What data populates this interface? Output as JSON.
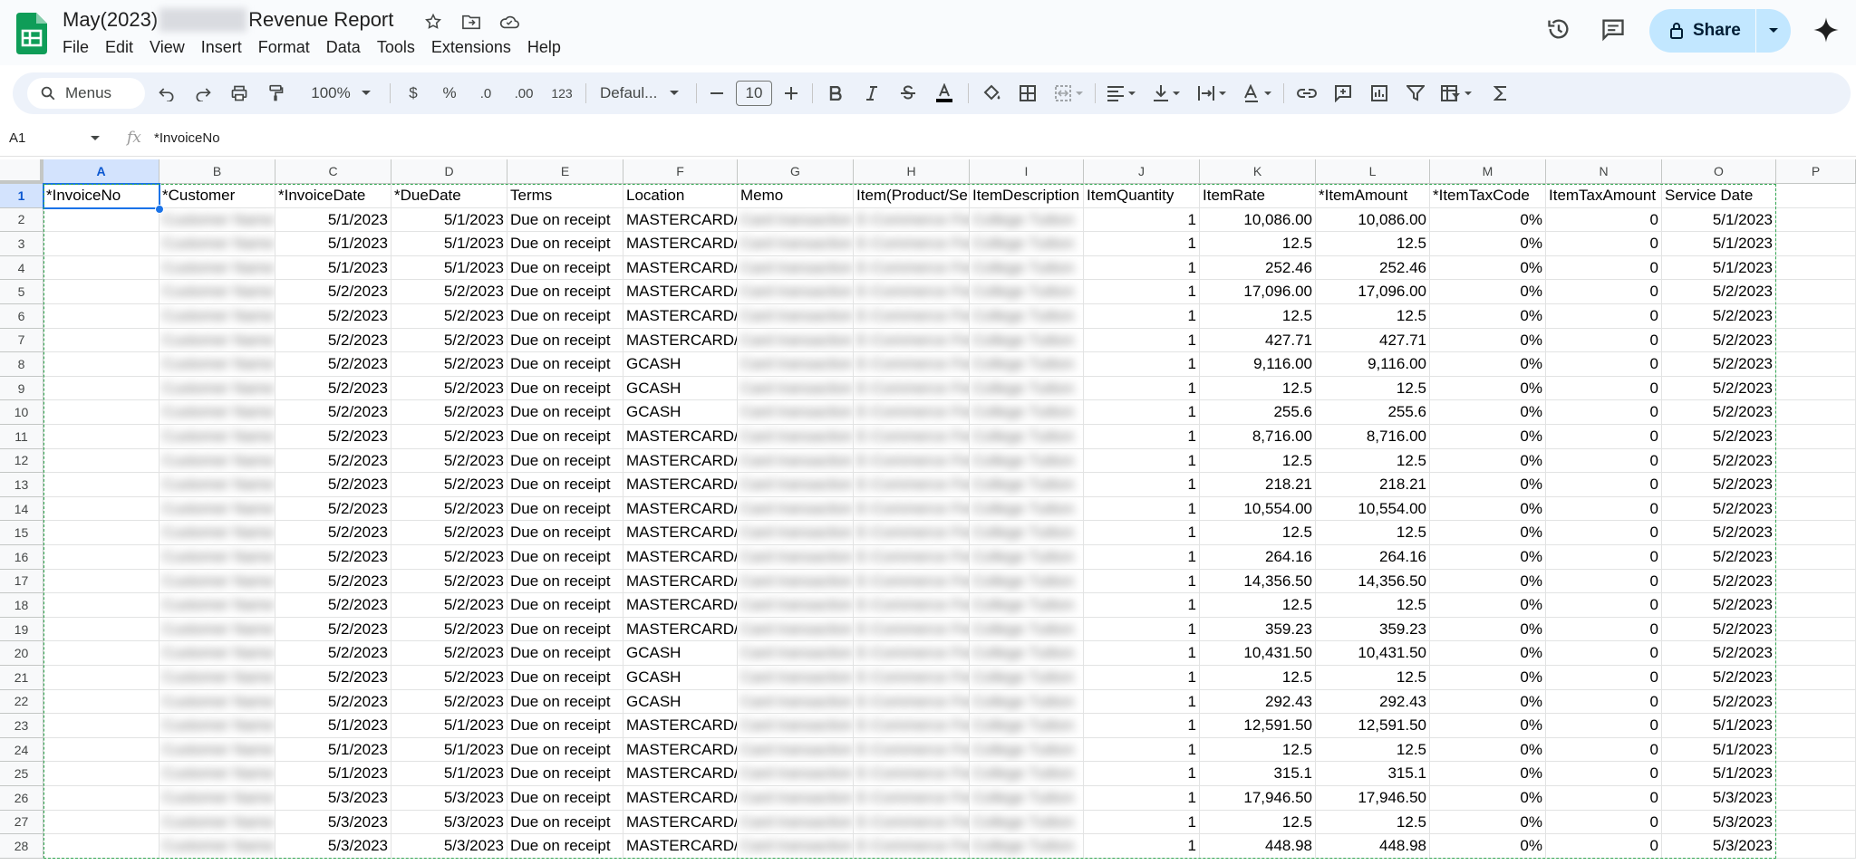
{
  "doc": {
    "title_prefix": "May(2023)",
    "title_suffix": "Revenue Report"
  },
  "menu": [
    "File",
    "Edit",
    "View",
    "Insert",
    "Format",
    "Data",
    "Tools",
    "Extensions",
    "Help"
  ],
  "share_label": "Share",
  "toolbar": {
    "search": "Menus",
    "zoom": "100%",
    "currency": "$",
    "percent": "%",
    "dec_decrease": ".0",
    "dec_increase": ".00",
    "format_123": "123",
    "font": "Defaul...",
    "font_size": "10"
  },
  "formula": {
    "cell_ref": "A1",
    "fx": "fx",
    "value": "*InvoiceNo"
  },
  "columns": [
    "A",
    "B",
    "C",
    "D",
    "E",
    "F",
    "G",
    "H",
    "I",
    "J",
    "K",
    "L",
    "M",
    "N",
    "O",
    "P"
  ],
  "headers": [
    "*InvoiceNo",
    "*Customer",
    "*InvoiceDate",
    "*DueDate",
    "Terms",
    "Location",
    "Memo",
    "Item(Product/Service)",
    "ItemDescription",
    "ItemQuantity",
    "ItemRate",
    "*ItemAmount",
    "*ItemTaxCode",
    "ItemTaxAmount",
    "Service Date"
  ],
  "rows": [
    {
      "n": "2",
      "inv": "5/1/2023",
      "due": "5/1/2023",
      "loc": "MASTERCARD/",
      "qty": "1",
      "rate": "10,086.00",
      "amt": "10,086.00",
      "tax": "0%",
      "taxamt": "0",
      "svc": "5/1/2023"
    },
    {
      "n": "3",
      "inv": "5/1/2023",
      "due": "5/1/2023",
      "loc": "MASTERCARD/",
      "qty": "1",
      "rate": "12.5",
      "amt": "12.5",
      "tax": "0%",
      "taxamt": "0",
      "svc": "5/1/2023"
    },
    {
      "n": "4",
      "inv": "5/1/2023",
      "due": "5/1/2023",
      "loc": "MASTERCARD/",
      "qty": "1",
      "rate": "252.46",
      "amt": "252.46",
      "tax": "0%",
      "taxamt": "0",
      "svc": "5/1/2023"
    },
    {
      "n": "5",
      "inv": "5/2/2023",
      "due": "5/2/2023",
      "loc": "MASTERCARD/",
      "qty": "1",
      "rate": "17,096.00",
      "amt": "17,096.00",
      "tax": "0%",
      "taxamt": "0",
      "svc": "5/2/2023"
    },
    {
      "n": "6",
      "inv": "5/2/2023",
      "due": "5/2/2023",
      "loc": "MASTERCARD/",
      "qty": "1",
      "rate": "12.5",
      "amt": "12.5",
      "tax": "0%",
      "taxamt": "0",
      "svc": "5/2/2023"
    },
    {
      "n": "7",
      "inv": "5/2/2023",
      "due": "5/2/2023",
      "loc": "MASTERCARD/",
      "qty": "1",
      "rate": "427.71",
      "amt": "427.71",
      "tax": "0%",
      "taxamt": "0",
      "svc": "5/2/2023"
    },
    {
      "n": "8",
      "inv": "5/2/2023",
      "due": "5/2/2023",
      "loc": "GCASH",
      "qty": "1",
      "rate": "9,116.00",
      "amt": "9,116.00",
      "tax": "0%",
      "taxamt": "0",
      "svc": "5/2/2023"
    },
    {
      "n": "9",
      "inv": "5/2/2023",
      "due": "5/2/2023",
      "loc": "GCASH",
      "qty": "1",
      "rate": "12.5",
      "amt": "12.5",
      "tax": "0%",
      "taxamt": "0",
      "svc": "5/2/2023"
    },
    {
      "n": "10",
      "inv": "5/2/2023",
      "due": "5/2/2023",
      "loc": "GCASH",
      "qty": "1",
      "rate": "255.6",
      "amt": "255.6",
      "tax": "0%",
      "taxamt": "0",
      "svc": "5/2/2023"
    },
    {
      "n": "11",
      "inv": "5/2/2023",
      "due": "5/2/2023",
      "loc": "MASTERCARD/",
      "qty": "1",
      "rate": "8,716.00",
      "amt": "8,716.00",
      "tax": "0%",
      "taxamt": "0",
      "svc": "5/2/2023"
    },
    {
      "n": "12",
      "inv": "5/2/2023",
      "due": "5/2/2023",
      "loc": "MASTERCARD/",
      "qty": "1",
      "rate": "12.5",
      "amt": "12.5",
      "tax": "0%",
      "taxamt": "0",
      "svc": "5/2/2023"
    },
    {
      "n": "13",
      "inv": "5/2/2023",
      "due": "5/2/2023",
      "loc": "MASTERCARD/",
      "qty": "1",
      "rate": "218.21",
      "amt": "218.21",
      "tax": "0%",
      "taxamt": "0",
      "svc": "5/2/2023"
    },
    {
      "n": "14",
      "inv": "5/2/2023",
      "due": "5/2/2023",
      "loc": "MASTERCARD/",
      "qty": "1",
      "rate": "10,554.00",
      "amt": "10,554.00",
      "tax": "0%",
      "taxamt": "0",
      "svc": "5/2/2023"
    },
    {
      "n": "15",
      "inv": "5/2/2023",
      "due": "5/2/2023",
      "loc": "MASTERCARD/",
      "qty": "1",
      "rate": "12.5",
      "amt": "12.5",
      "tax": "0%",
      "taxamt": "0",
      "svc": "5/2/2023"
    },
    {
      "n": "16",
      "inv": "5/2/2023",
      "due": "5/2/2023",
      "loc": "MASTERCARD/",
      "qty": "1",
      "rate": "264.16",
      "amt": "264.16",
      "tax": "0%",
      "taxamt": "0",
      "svc": "5/2/2023"
    },
    {
      "n": "17",
      "inv": "5/2/2023",
      "due": "5/2/2023",
      "loc": "MASTERCARD/",
      "qty": "1",
      "rate": "14,356.50",
      "amt": "14,356.50",
      "tax": "0%",
      "taxamt": "0",
      "svc": "5/2/2023"
    },
    {
      "n": "18",
      "inv": "5/2/2023",
      "due": "5/2/2023",
      "loc": "MASTERCARD/",
      "qty": "1",
      "rate": "12.5",
      "amt": "12.5",
      "tax": "0%",
      "taxamt": "0",
      "svc": "5/2/2023"
    },
    {
      "n": "19",
      "inv": "5/2/2023",
      "due": "5/2/2023",
      "loc": "MASTERCARD/",
      "qty": "1",
      "rate": "359.23",
      "amt": "359.23",
      "tax": "0%",
      "taxamt": "0",
      "svc": "5/2/2023"
    },
    {
      "n": "20",
      "inv": "5/2/2023",
      "due": "5/2/2023",
      "loc": "GCASH",
      "qty": "1",
      "rate": "10,431.50",
      "amt": "10,431.50",
      "tax": "0%",
      "taxamt": "0",
      "svc": "5/2/2023"
    },
    {
      "n": "21",
      "inv": "5/2/2023",
      "due": "5/2/2023",
      "loc": "GCASH",
      "qty": "1",
      "rate": "12.5",
      "amt": "12.5",
      "tax": "0%",
      "taxamt": "0",
      "svc": "5/2/2023"
    },
    {
      "n": "22",
      "inv": "5/2/2023",
      "due": "5/2/2023",
      "loc": "GCASH",
      "qty": "1",
      "rate": "292.43",
      "amt": "292.43",
      "tax": "0%",
      "taxamt": "0",
      "svc": "5/2/2023"
    },
    {
      "n": "23",
      "inv": "5/1/2023",
      "due": "5/1/2023",
      "loc": "MASTERCARD/",
      "qty": "1",
      "rate": "12,591.50",
      "amt": "12,591.50",
      "tax": "0%",
      "taxamt": "0",
      "svc": "5/1/2023"
    },
    {
      "n": "24",
      "inv": "5/1/2023",
      "due": "5/1/2023",
      "loc": "MASTERCARD/",
      "qty": "1",
      "rate": "12.5",
      "amt": "12.5",
      "tax": "0%",
      "taxamt": "0",
      "svc": "5/1/2023"
    },
    {
      "n": "25",
      "inv": "5/1/2023",
      "due": "5/1/2023",
      "loc": "MASTERCARD/",
      "qty": "1",
      "rate": "315.1",
      "amt": "315.1",
      "tax": "0%",
      "taxamt": "0",
      "svc": "5/1/2023"
    },
    {
      "n": "26",
      "inv": "5/3/2023",
      "due": "5/3/2023",
      "loc": "MASTERCARD/",
      "qty": "1",
      "rate": "17,946.50",
      "amt": "17,946.50",
      "tax": "0%",
      "taxamt": "0",
      "svc": "5/3/2023"
    },
    {
      "n": "27",
      "inv": "5/3/2023",
      "due": "5/3/2023",
      "loc": "MASTERCARD/",
      "qty": "1",
      "rate": "12.5",
      "amt": "12.5",
      "tax": "0%",
      "taxamt": "0",
      "svc": "5/3/2023"
    },
    {
      "n": "28",
      "inv": "5/3/2023",
      "due": "5/3/2023",
      "loc": "MASTERCARD/",
      "qty": "1",
      "rate": "448.98",
      "amt": "448.98",
      "tax": "0%",
      "taxamt": "0",
      "svc": "5/3/2023"
    }
  ],
  "terms_value": "Due on receipt",
  "colors": {
    "accent": "#1a73e8",
    "share_bg": "#c2e7ff",
    "sheets_green": "#0f9d58",
    "selection_bg": "#d3e3fd"
  }
}
